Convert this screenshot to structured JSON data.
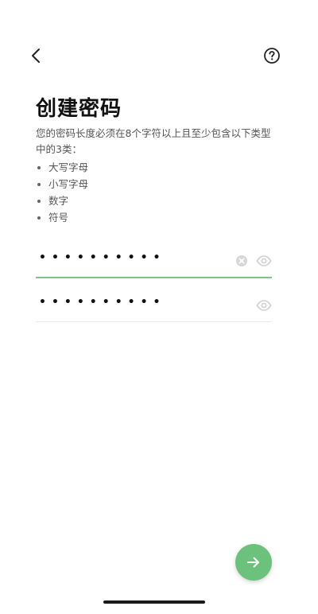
{
  "header": {
    "back_icon": "chevron-left-icon",
    "help_icon": "question-circle-icon"
  },
  "page": {
    "title": "创建密码",
    "description": "您的密码长度必须在8个字符以上且至少包含以下类型中的3类：",
    "requirements": [
      "大写字母",
      "小写字母",
      "数字",
      "符号"
    ]
  },
  "password_field": {
    "masked_value": "••••••••••",
    "clear_icon": "clear-circle-icon",
    "visibility_icon": "eye-icon"
  },
  "confirm_field": {
    "masked_value": "••••••••••",
    "visibility_icon": "eye-icon"
  },
  "next_button": {
    "icon": "arrow-right-icon"
  },
  "colors": {
    "accent": "#6cc27d",
    "active_underline": "#7cc38b",
    "text_primary": "#111111",
    "text_secondary": "#555555"
  }
}
